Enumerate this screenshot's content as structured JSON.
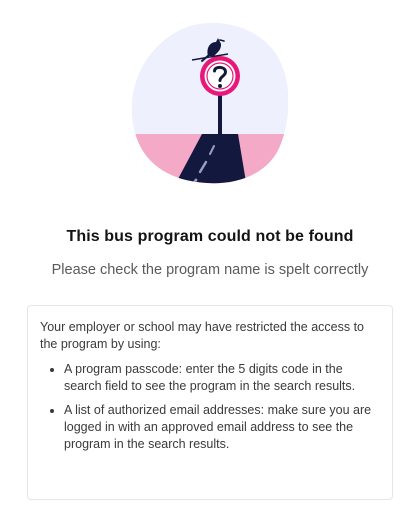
{
  "empty_state": {
    "illustration_icon": "question-sign-icon",
    "title": "This bus program could not be found",
    "subtitle": "Please check the program name is spelt correctly"
  },
  "info": {
    "intro": "Your employer or school may have restricted the access to the program by using:",
    "items": [
      {
        "text": "A program passcode: enter the 5 digits code in the search field to see the program in the search results."
      },
      {
        "text": "A list of authorized email addresses: make sure you are logged in with an approved email address to see the program in the search results."
      }
    ]
  },
  "colors": {
    "accent_pink": "#e8177a",
    "navy": "#13183f",
    "light_pink": "#f4a9c6",
    "blob_background": "#eef1fd"
  }
}
